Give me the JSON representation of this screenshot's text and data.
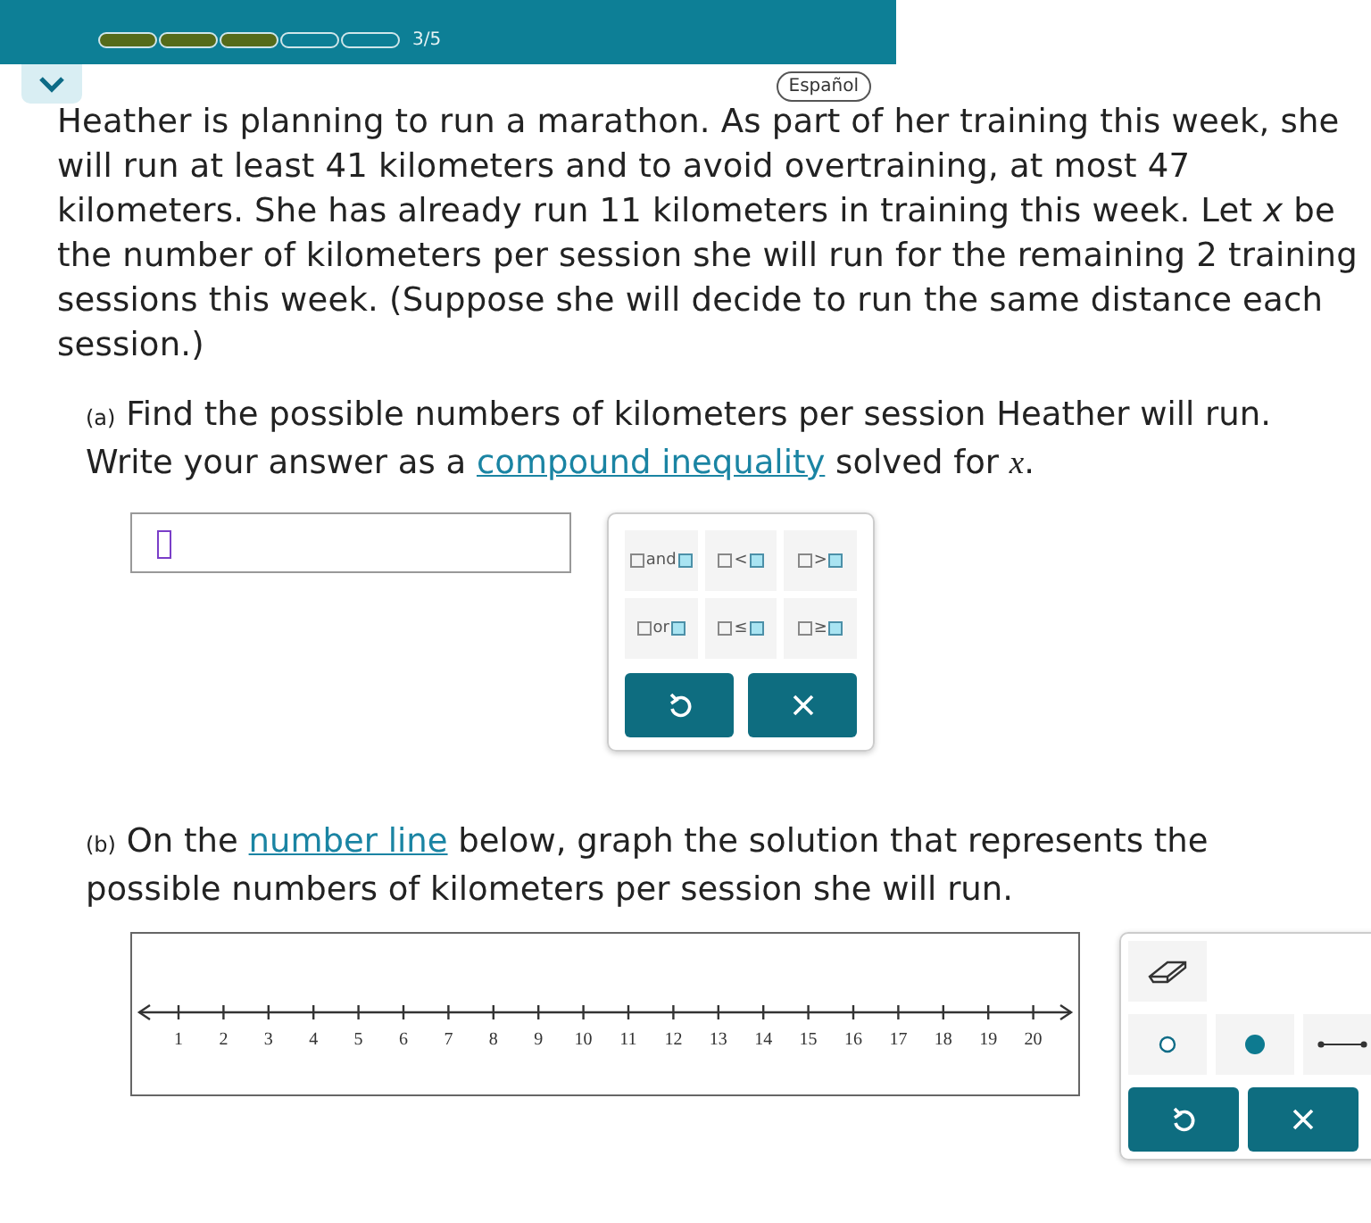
{
  "header": {
    "progress": {
      "segments": [
        {
          "filled": true
        },
        {
          "filled": true
        },
        {
          "filled": true
        },
        {
          "filled": false
        },
        {
          "filled": false
        }
      ],
      "label": "3/5"
    }
  },
  "language_button": "Español",
  "problem": "Heather is planning to run a marathon. As part of her training this week, she will run at least 41 kilometers and to avoid overtraining, at most 47 kilometers. She has already run 11 kilometers in training this week. Let *x* be the number of kilometers per session she will run for the remaining 2 training sessions this week. (Suppose she will decide to run the same distance each session.)",
  "part_a": {
    "marker": "(a)",
    "parts": [
      {
        "kind": "text",
        "text": "Find the possible numbers of kilometers per session Heather will run. Write your answer as a "
      },
      {
        "kind": "link",
        "text": "compound inequality"
      },
      {
        "kind": "text",
        "text": " solved for "
      },
      {
        "kind": "var",
        "text": "x"
      },
      {
        "kind": "text",
        "text": "."
      }
    ]
  },
  "palette": {
    "keys": [
      {
        "label": "and"
      },
      {
        "label": "<"
      },
      {
        "label": ">"
      },
      {
        "label": "or"
      },
      {
        "label": "≤"
      },
      {
        "label": "≥"
      }
    ]
  },
  "part_b": {
    "marker": "(b)",
    "parts": [
      {
        "kind": "text",
        "text": "On the "
      },
      {
        "kind": "link",
        "text": "number line"
      },
      {
        "kind": "text",
        "text": " below, graph the solution that represents the possible numbers of kilometers per session she will run."
      }
    ]
  },
  "number_line": {
    "ticks": [
      "1",
      "2",
      "3",
      "4",
      "5",
      "6",
      "7",
      "8",
      "9",
      "10",
      "11",
      "12",
      "13",
      "14",
      "15",
      "16",
      "17",
      "18",
      "19",
      "20"
    ]
  },
  "graph_tools": [
    {
      "kind": "eraser"
    },
    {
      "kind": "open-point"
    },
    {
      "kind": "closed-point"
    },
    {
      "kind": "segment"
    }
  ]
}
